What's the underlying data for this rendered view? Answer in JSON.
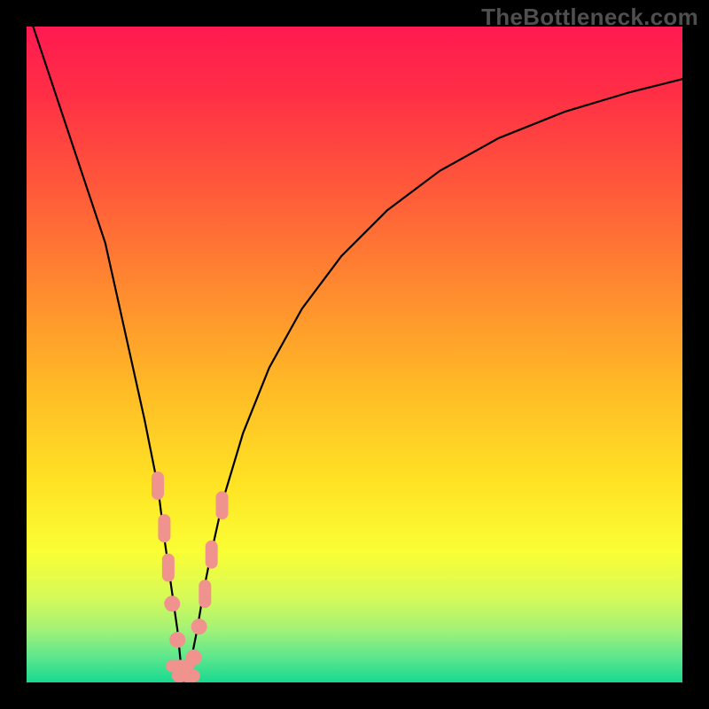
{
  "watermark": "TheBottleneck.com",
  "chart_data": {
    "type": "line",
    "title": "",
    "xlabel": "",
    "ylabel": "",
    "xlim": [
      0,
      100
    ],
    "ylim": [
      0,
      100
    ],
    "series": [
      {
        "name": "bottleneck-curve",
        "x": [
          0,
          3,
          6,
          9,
          12,
          14,
          16,
          18,
          20,
          21,
          22,
          23,
          23.5,
          24,
          25,
          26,
          27,
          28,
          30,
          33,
          37,
          42,
          48,
          55,
          63,
          72,
          82,
          92,
          100
        ],
        "values": [
          103,
          94,
          85,
          76,
          67,
          58,
          49,
          40,
          30,
          22,
          15,
          8,
          3,
          0,
          3,
          8,
          14,
          19,
          28,
          38,
          48,
          57,
          65,
          72,
          78,
          83,
          87,
          90,
          92
        ]
      }
    ],
    "markers": {
      "name": "highlighted-points",
      "color": "#f0938e",
      "points": [
        {
          "x": 20.0,
          "y": 30.0,
          "shape": "pill-v"
        },
        {
          "x": 21.0,
          "y": 23.5,
          "shape": "pill-v"
        },
        {
          "x": 21.6,
          "y": 17.5,
          "shape": "pill-v"
        },
        {
          "x": 22.2,
          "y": 12.0,
          "shape": "circle"
        },
        {
          "x": 23.0,
          "y": 6.5,
          "shape": "circle"
        },
        {
          "x": 23.4,
          "y": 2.5,
          "shape": "pill-h"
        },
        {
          "x": 24.3,
          "y": 1.0,
          "shape": "pill-h"
        },
        {
          "x": 25.5,
          "y": 3.8,
          "shape": "circle"
        },
        {
          "x": 26.3,
          "y": 8.5,
          "shape": "circle"
        },
        {
          "x": 27.2,
          "y": 13.5,
          "shape": "pill-v"
        },
        {
          "x": 28.2,
          "y": 19.5,
          "shape": "pill-v"
        },
        {
          "x": 29.8,
          "y": 27.0,
          "shape": "pill-v"
        }
      ]
    },
    "gradient_stops": [
      {
        "offset": 0.0,
        "color": "#ff1a51"
      },
      {
        "offset": 0.1,
        "color": "#ff2e46"
      },
      {
        "offset": 0.25,
        "color": "#ff5a3a"
      },
      {
        "offset": 0.4,
        "color": "#ff8a2f"
      },
      {
        "offset": 0.55,
        "color": "#ffba26"
      },
      {
        "offset": 0.7,
        "color": "#ffe424"
      },
      {
        "offset": 0.8,
        "color": "#fafe34"
      },
      {
        "offset": 0.87,
        "color": "#d6fa58"
      },
      {
        "offset": 0.92,
        "color": "#a2f276"
      },
      {
        "offset": 0.96,
        "color": "#5fe78e"
      },
      {
        "offset": 1.0,
        "color": "#18d98f"
      }
    ]
  }
}
